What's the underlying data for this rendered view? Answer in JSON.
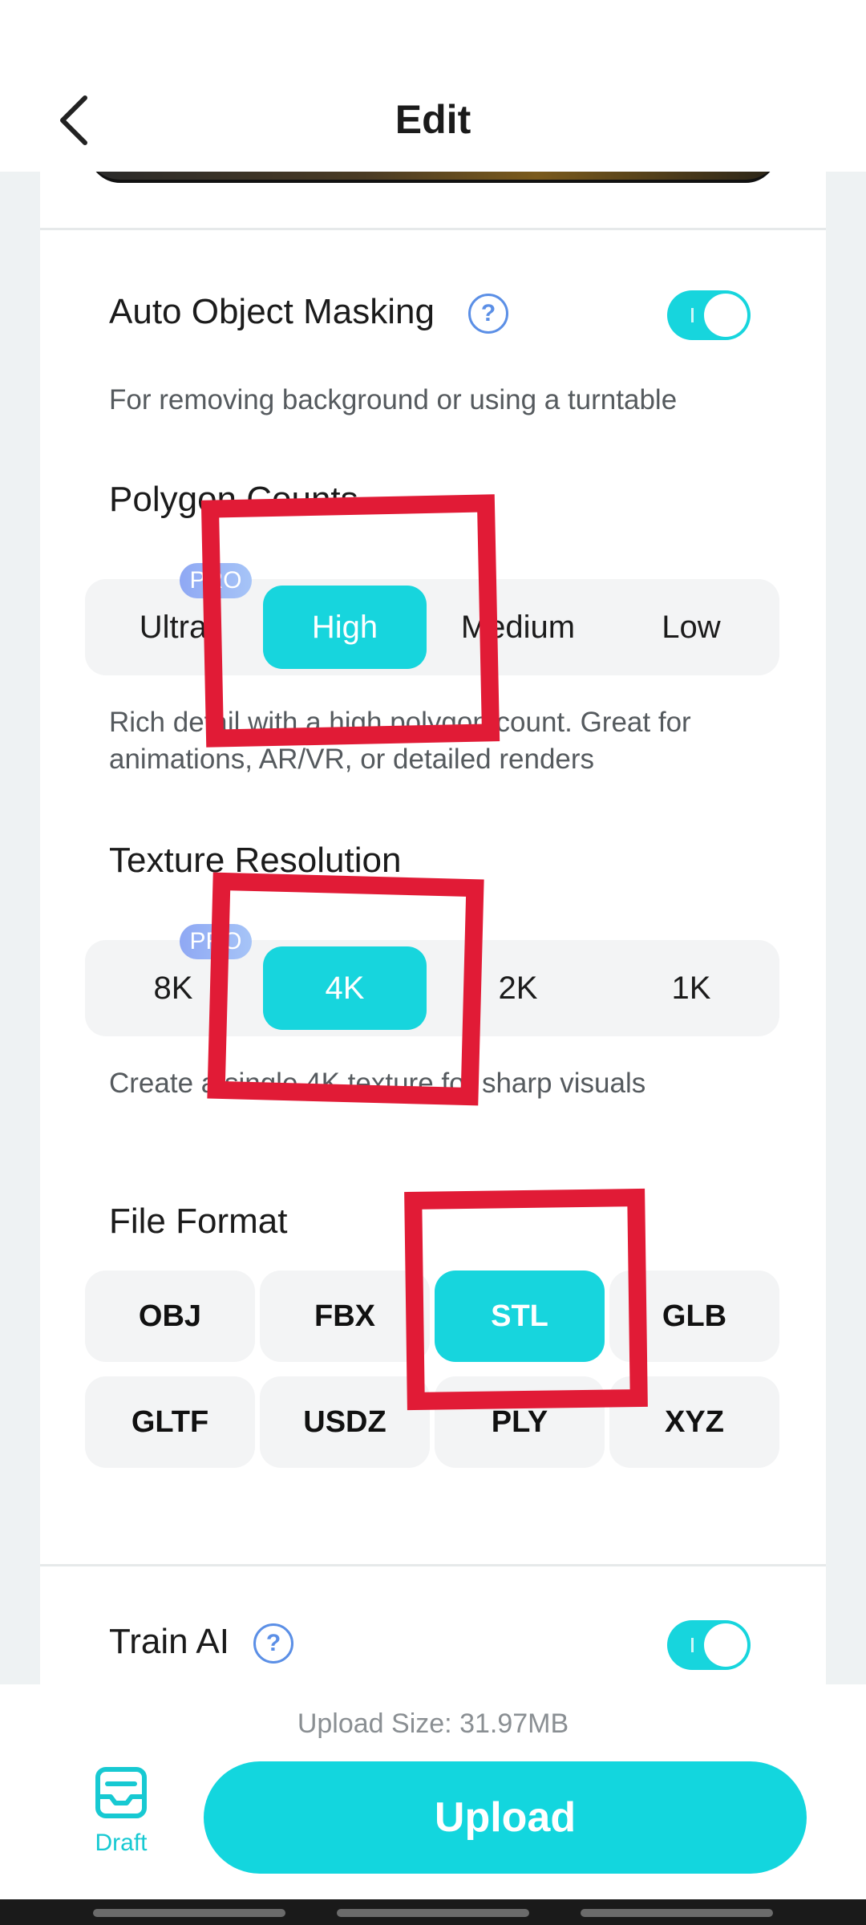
{
  "header": {
    "title": "Edit",
    "back": "back-arrow-icon"
  },
  "masking": {
    "label": "Auto Object Masking",
    "help": "?",
    "enabled": true,
    "description": "For removing background or using a turntable"
  },
  "polygon": {
    "label": "Polygon Counts",
    "badge": "PRO",
    "options": [
      "Ultra",
      "High",
      "Medium",
      "Low"
    ],
    "selected": "High",
    "description": "Rich detail with a high polygon count. Great for animations, AR/VR, or detailed renders"
  },
  "texture": {
    "label": "Texture Resolution",
    "badge": "PRO",
    "options": [
      "8K",
      "4K",
      "2K",
      "1K"
    ],
    "selected": "4K",
    "description": "Create a single 4K texture for sharp visuals"
  },
  "format": {
    "label": "File Format",
    "options": [
      "OBJ",
      "FBX",
      "STL",
      "GLB",
      "GLTF",
      "USDZ",
      "PLY",
      "XYZ"
    ],
    "selected": "STL"
  },
  "train": {
    "label": "Train AI",
    "help": "?",
    "enabled": true
  },
  "footer": {
    "upload_size": "Upload Size: 31.97MB",
    "draft_label": "Draft",
    "upload_label": "Upload"
  },
  "colors": {
    "accent": "#17d5dd",
    "highlight": "#e11b36",
    "pro_badge": "#8fa8f4"
  }
}
